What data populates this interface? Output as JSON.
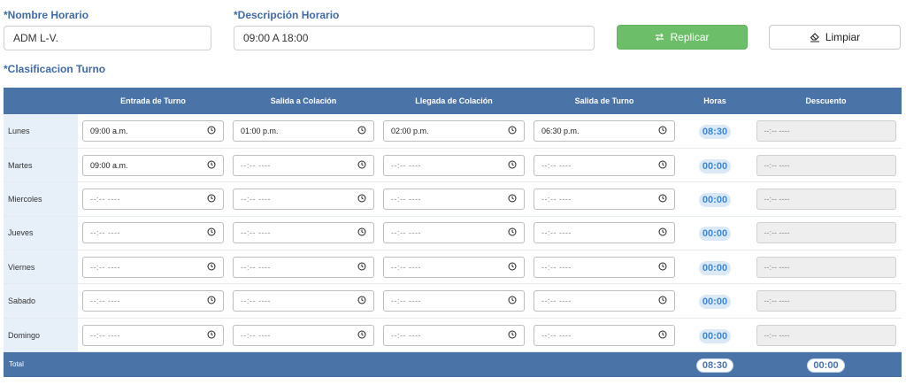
{
  "form": {
    "name_label": "*Nombre Horario",
    "name_value": "ADM L-V.",
    "desc_label": "*Descripción Horario",
    "desc_value": "09:00 A 18:00",
    "replicate_label": "Replicar",
    "clear_label": "Limpiar",
    "shift_class_label": "*Clasificacion Turno"
  },
  "table": {
    "columns": [
      "",
      "Entrada de Turno",
      "Salida a Colación",
      "Llegada de Colación",
      "Salida de Turno",
      "Horas",
      "Descuento"
    ],
    "empty_time": "--:-- ----",
    "rows": [
      {
        "day": "Lunes",
        "entrada": "09:00 a.m.",
        "salida_colacion": "01:00 p.m.",
        "llegada_colacion": "02:00 p.m.",
        "salida_turno": "06:30 p.m.",
        "horas": "08:30",
        "descuento": "--:-- ----"
      },
      {
        "day": "Martes",
        "entrada": "09:00 a.m.",
        "salida_colacion": "--:-- ----",
        "llegada_colacion": "--:-- ----",
        "salida_turno": "--:-- ----",
        "horas": "00:00",
        "descuento": "--:-- ----"
      },
      {
        "day": "Miercoles",
        "entrada": "--:-- ----",
        "salida_colacion": "--:-- ----",
        "llegada_colacion": "--:-- ----",
        "salida_turno": "--:-- ----",
        "horas": "00:00",
        "descuento": "--:-- ----"
      },
      {
        "day": "Jueves",
        "entrada": "--:-- ----",
        "salida_colacion": "--:-- ----",
        "llegada_colacion": "--:-- ----",
        "salida_turno": "--:-- ----",
        "horas": "00:00",
        "descuento": "--:-- ----"
      },
      {
        "day": "Viernes",
        "entrada": "--:-- ----",
        "salida_colacion": "--:-- ----",
        "llegada_colacion": "--:-- ----",
        "salida_turno": "--:-- ----",
        "horas": "00:00",
        "descuento": "--:-- ----"
      },
      {
        "day": "Sabado",
        "entrada": "--:-- ----",
        "salida_colacion": "--:-- ----",
        "llegada_colacion": "--:-- ----",
        "salida_turno": "--:-- ----",
        "horas": "00:00",
        "descuento": "--:-- ----"
      },
      {
        "day": "Domingo",
        "entrada": "--:-- ----",
        "salida_colacion": "--:-- ----",
        "llegada_colacion": "--:-- ----",
        "salida_turno": "--:-- ----",
        "horas": "00:00",
        "descuento": "--:-- ----"
      }
    ],
    "total": {
      "label": "Total",
      "horas": "08:30",
      "descuento": "00:00"
    }
  },
  "icons": {
    "replicate": "swap-arrows-icon",
    "clear": "eraser-icon",
    "time": "clock-icon"
  },
  "colors": {
    "header_blue": "#4a73a8",
    "label_blue": "#3f6aa6",
    "green_button": "#6cbf68",
    "day_cell_bg": "#e7f0f8",
    "hours_text": "#3a86d1"
  }
}
